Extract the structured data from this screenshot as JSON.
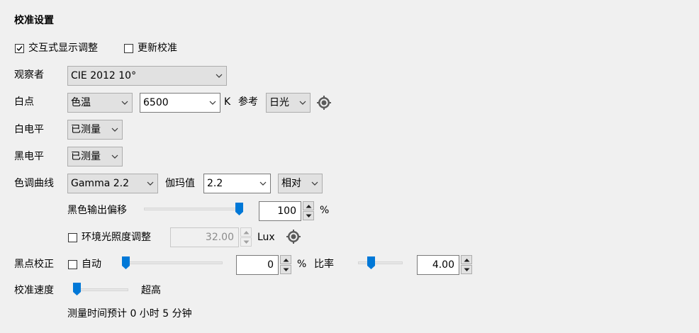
{
  "section_title": "校准设置",
  "interactive_adjust": {
    "label": "交互式显示调整",
    "checked": true
  },
  "update_calibration": {
    "label": "更新校准",
    "checked": false
  },
  "observer": {
    "label": "观察者",
    "value": "CIE 2012 10°"
  },
  "whitepoint": {
    "label": "白点",
    "mode": "色温",
    "temperature": "6500",
    "unit": "K",
    "reference_label": "参考",
    "reference_value": "日光",
    "icon": "locator-icon"
  },
  "white_level": {
    "label": "白电平",
    "value": "已测量"
  },
  "black_level": {
    "label": "黑电平",
    "value": "已测量"
  },
  "tone_curve": {
    "label": "色调曲线",
    "value": "Gamma 2.2",
    "gamma_label": "伽玛值",
    "gamma_value": "2.2",
    "gamma_mode": "相对"
  },
  "black_output_offset": {
    "label": "黑色输出偏移",
    "value": "100",
    "unit": "%",
    "level": 1.0
  },
  "ambient": {
    "label": "环境光照度调整",
    "checked": false,
    "value": "32.00",
    "unit": "Lux",
    "icon": "locator-icon"
  },
  "black_point_correction": {
    "label": "黑点校正",
    "auto_label": "自动",
    "auto_checked": false,
    "value": "0",
    "unit": "%",
    "level": 0.0,
    "rate_label": "比率",
    "rate_value": "4.00",
    "rate_level": 0.25
  },
  "calibration_speed": {
    "label": "校准速度",
    "value_label": "超高",
    "level": 0.0
  },
  "estimate": "测量时间预计 0 小时 5 分钟"
}
